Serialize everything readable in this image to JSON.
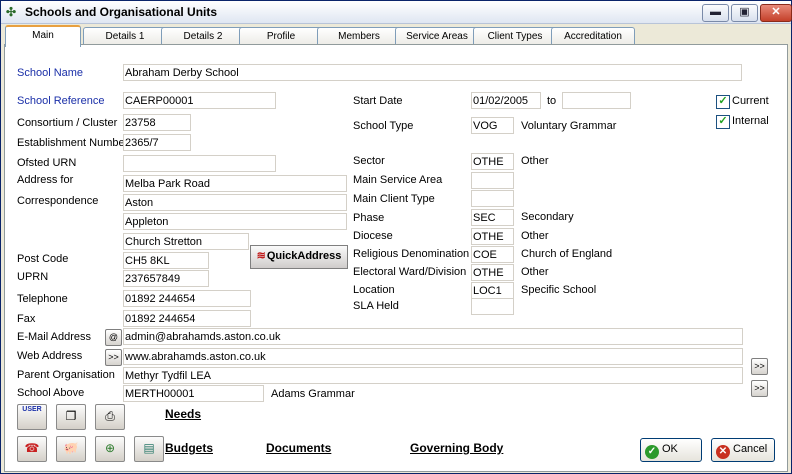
{
  "window": {
    "title": "Schools and Organisational Units"
  },
  "tabs": [
    "Main",
    "Details 1",
    "Details 2",
    "Profile",
    "Members",
    "Service Areas",
    "Client Types",
    "Accreditation"
  ],
  "left": {
    "school_name_label": "School Name",
    "school_name": "Abraham Derby School",
    "school_reference_label": "School Reference",
    "school_reference": "CAERP00001",
    "consortium_label": "Consortium / Cluster",
    "consortium": "23758",
    "establishment_label": "Establishment Number",
    "establishment": "2365/7",
    "ofsted_label": "Ofsted URN",
    "ofsted": "",
    "address_label_1": "Address for",
    "address_label_2": "Correspondence",
    "address": [
      "Melba Park Road",
      "Aston",
      "Appleton",
      "Church Stretton"
    ],
    "quickaddress_mark": "≋",
    "quickaddress_label": "QuickAddress",
    "postcode_label": "Post Code",
    "postcode": "CH5 8KL",
    "uprn_label": "UPRN",
    "uprn": "237657849",
    "telephone_label": "Telephone",
    "telephone": "01892 244654",
    "fax_label": "Fax",
    "fax": "01892 244654",
    "email_label": "E-Mail Address",
    "email_btn": "@",
    "email": "admin@abrahamds.aston.co.uk",
    "web_label": "Web Address",
    "web_btn": ">>",
    "web": "www.abrahamds.aston.co.uk",
    "parent_label": "Parent Organisation",
    "parent": "Methyr Tydfil LEA",
    "school_above_label": "School Above",
    "school_above_code": "MERTH00001",
    "school_above_name": "Adams Grammar"
  },
  "right": {
    "start_date_label": "Start Date",
    "start_date": "01/02/2005",
    "to_label": "to",
    "end_date": "",
    "current_label": "Current",
    "internal_label": "Internal",
    "check_mark": "✓",
    "school_type_label": "School Type",
    "school_type_code": "VOG",
    "school_type_desc": "Voluntary Grammar",
    "sector_label": "Sector",
    "sector_code": "OTHE",
    "sector_desc": "Other",
    "main_service_label": "Main Service Area",
    "main_service_code": "",
    "main_client_label": "Main Client Type",
    "main_client_code": "",
    "phase_label": "Phase",
    "phase_code": "SEC",
    "phase_desc": "Secondary",
    "diocese_label": "Diocese",
    "diocese_code": "OTHE",
    "diocese_desc": "Other",
    "religion_label": "Religious Denomination",
    "religion_code": "COE",
    "religion_desc": "Church of England",
    "ward_label": "Electoral Ward/Division",
    "ward_code": "OTHE",
    "ward_desc": "Other",
    "location_label": "Location",
    "location_code": "LOC1",
    "location_desc": "Specific School",
    "sla_label": "SLA Held",
    "sla_code": "",
    "more_btn_1": ">>",
    "more_btn_2": ">>"
  },
  "footer": {
    "user_icon_text": "USER",
    "needs_link": "Needs",
    "budgets_link": "Budgets",
    "documents_link": "Documents",
    "governing_link": "Governing Body",
    "ok_label": "OK",
    "cancel_label": "Cancel"
  },
  "colors": {
    "accent_blue": "#1a2fa8",
    "ok_green": "#2c9a2c",
    "cancel_red": "#c83020",
    "tab_active_border": "#e8a040"
  }
}
